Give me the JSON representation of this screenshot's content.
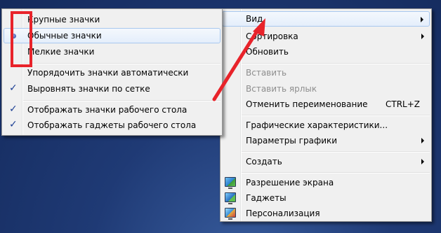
{
  "main_menu": {
    "items": [
      {
        "label": "Вид"
      },
      {
        "label": "Сортировка"
      },
      {
        "label": "Обновить"
      },
      {
        "label": "Вставить"
      },
      {
        "label": "Вставить ярлык"
      },
      {
        "label": "Отменить переименование",
        "shortcut": "CTRL+Z"
      },
      {
        "label": "Графические характеристики..."
      },
      {
        "label": "Параметры графики"
      },
      {
        "label": "Создать"
      },
      {
        "label": "Разрешение экрана",
        "icon": "screen-resolution-icon"
      },
      {
        "label": "Гаджеты",
        "icon": "gadgets-icon"
      },
      {
        "label": "Персонализация",
        "icon": "personalization-icon"
      }
    ]
  },
  "view_submenu": {
    "items": [
      {
        "label": "Крупные значки"
      },
      {
        "label": "Обычные значки",
        "radio": "radio-selected-icon"
      },
      {
        "label": "Мелкие значки"
      },
      {
        "label": "Упорядочить значки автоматически"
      },
      {
        "label": "Выровнять значки по сетке",
        "check": "checkmark-icon"
      },
      {
        "label": "Отображать значки рабочего стола",
        "check": "checkmark-icon"
      },
      {
        "label": "Отображать гаджеты  рабочего стола",
        "check": "checkmark-icon"
      }
    ],
    "check_glyph": "✓"
  },
  "annotations": {
    "highlight_color": "#e8232a",
    "arrow_color": "#e8232a"
  }
}
